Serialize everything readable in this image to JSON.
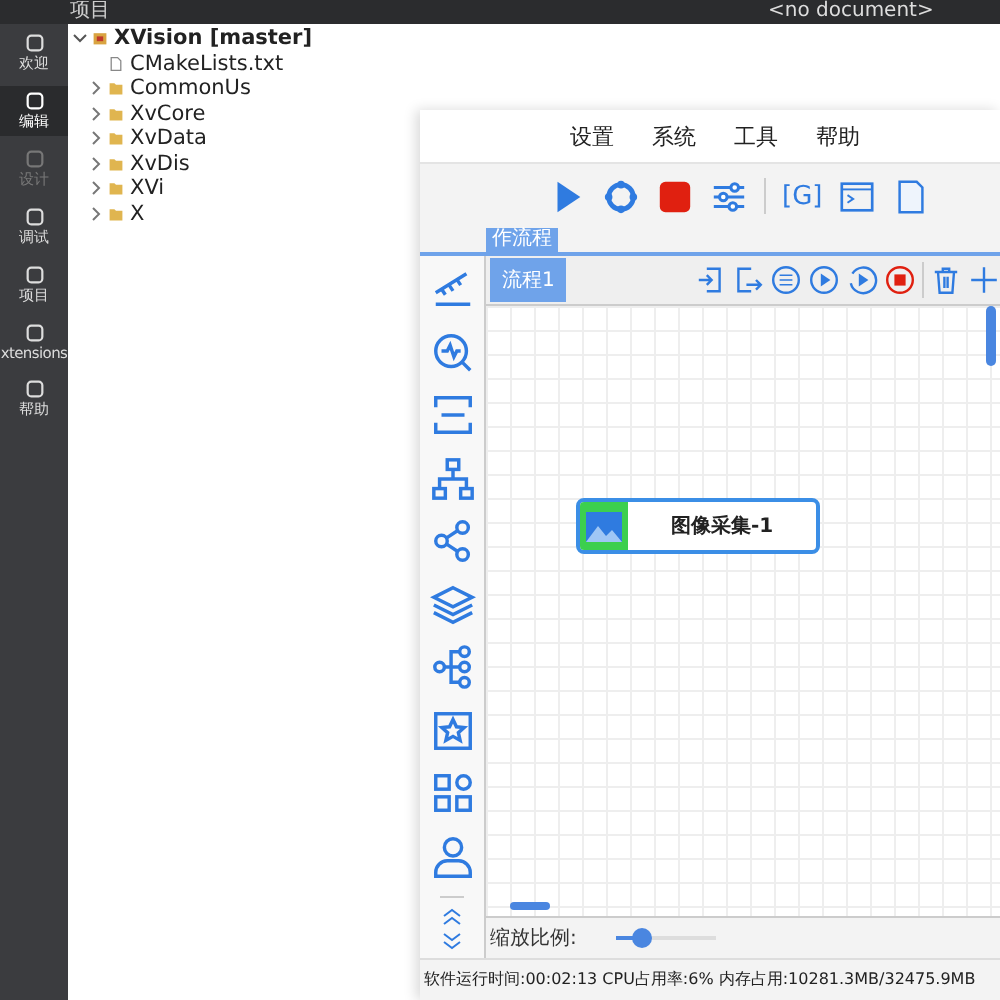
{
  "top_bar": {
    "panel_title": "项目",
    "document": "<no document>"
  },
  "mode_bar": [
    {
      "label": "欢迎",
      "selected": false,
      "disabled": false
    },
    {
      "label": "编辑",
      "selected": true,
      "disabled": false
    },
    {
      "label": "设计",
      "selected": false,
      "disabled": true
    },
    {
      "label": "调试",
      "selected": false,
      "disabled": false
    },
    {
      "label": "项目",
      "selected": false,
      "disabled": false
    },
    {
      "label": "xtensions",
      "selected": false,
      "disabled": false
    },
    {
      "label": "帮助",
      "selected": false,
      "disabled": false
    }
  ],
  "project_tree": {
    "label": "XVision [master]",
    "expanded": true,
    "children": [
      {
        "label": "CMakeLists.txt",
        "kind": "file"
      },
      {
        "label": "CommonUs",
        "kind": "folder",
        "expanded": false
      },
      {
        "label": "XvCore",
        "kind": "folder",
        "expanded": false
      },
      {
        "label": "XvData",
        "kind": "folder",
        "expanded": false
      },
      {
        "label": "XvDis",
        "kind": "folder",
        "expanded": false
      },
      {
        "label": "XVi",
        "kind": "folder",
        "expanded": false
      },
      {
        "label": "X",
        "kind": "folder",
        "expanded": false
      }
    ]
  },
  "app": {
    "menu": [
      "设置",
      "系统",
      "工具",
      "帮助"
    ],
    "toolbar_text": "[G]",
    "workflow_tab": "作流程",
    "flow_tabs": [
      {
        "label": "流程1",
        "selected": true
      }
    ],
    "node": {
      "label": "图像采集-1"
    },
    "zoom": {
      "label": "缩放比例:",
      "level": 0.25
    },
    "status": "软件运行时间:00:02:13  CPU占用率:6% 内存占用:10281.3MB/32475.9MB"
  }
}
